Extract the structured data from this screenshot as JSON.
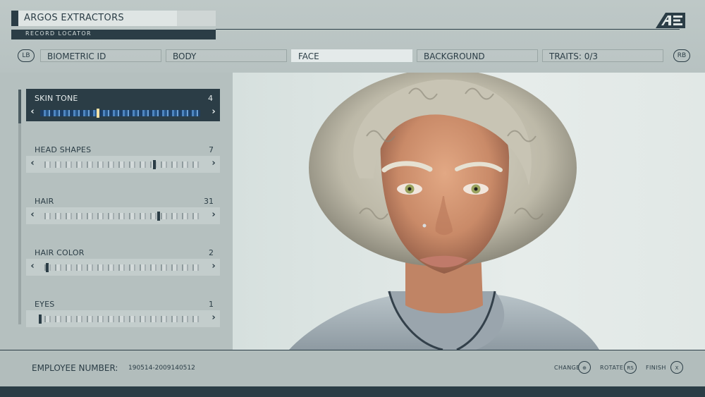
{
  "header": {
    "company": "ARGOS EXTRACTORS",
    "record_locator": "RECORD LOCATOR",
    "logo_text": "AE"
  },
  "tabs": {
    "left_bumper": "LB",
    "right_bumper": "RB",
    "items": [
      {
        "label": "BIOMETRIC ID",
        "active": false
      },
      {
        "label": "BODY",
        "active": false
      },
      {
        "label": "FACE",
        "active": true
      },
      {
        "label": "BACKGROUND",
        "active": false
      },
      {
        "label": "TRAITS: 0/3",
        "active": false
      }
    ]
  },
  "face_options": [
    {
      "label": "SKIN TONE",
      "value": "4",
      "selected": true
    },
    {
      "label": "HEAD SHAPES",
      "value": "7",
      "selected": false
    },
    {
      "label": "HAIR",
      "value": "31",
      "selected": false
    },
    {
      "label": "HAIR COLOR",
      "value": "2",
      "selected": false
    },
    {
      "label": "EYES",
      "value": "1",
      "selected": false
    }
  ],
  "arrows": {
    "left": "‹",
    "right": "›"
  },
  "footer": {
    "employee_label": "EMPLOYEE NUMBER:",
    "employee_number": "190514-2009140512",
    "prompts": [
      {
        "label": "CHANGE",
        "button": "⊕"
      },
      {
        "label": "ROTATE",
        "button": "RS"
      },
      {
        "label": "FINISH",
        "button": "X"
      }
    ]
  },
  "colors": {
    "ui_dark": "#2b3d46",
    "panel_bg": "#b5c0bf",
    "selected_marker": "#f4e1a5"
  }
}
